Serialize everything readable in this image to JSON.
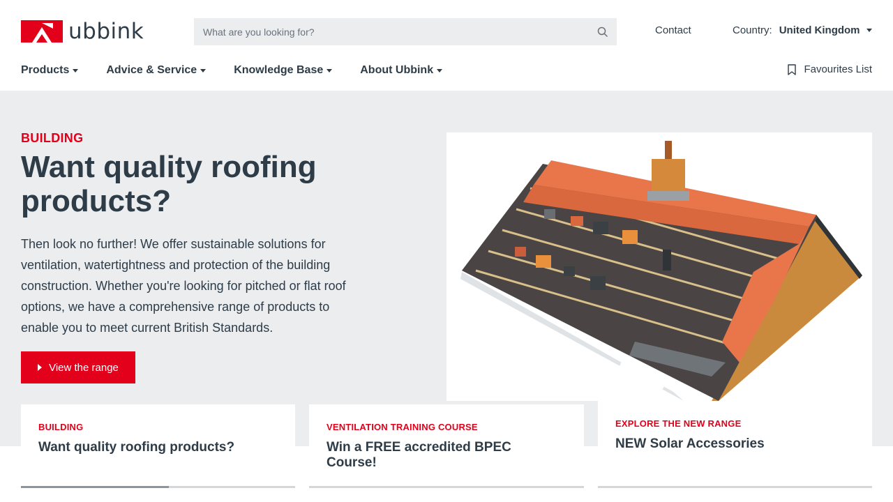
{
  "header": {
    "logo_text": "ubbink",
    "search_placeholder": "What are you looking for?",
    "contact_label": "Contact",
    "country_label": "Country:",
    "country_value": "United Kingdom",
    "favourites_label": "Favourites List"
  },
  "nav": {
    "items": [
      {
        "label": "Products"
      },
      {
        "label": "Advice & Service"
      },
      {
        "label": "Knowledge Base"
      },
      {
        "label": "About Ubbink"
      }
    ]
  },
  "hero": {
    "eyebrow": "BUILDING",
    "title": "Want quality roofing products?",
    "text": "Then look no further! We offer sustainable solutions for ventilation, watertightness and protection of the building construction. Whether you're looking for pitched or flat roof options, we have a comprehensive range of products to enable you to meet current British Standards.",
    "cta_label": "View the range"
  },
  "cards": [
    {
      "eyebrow": "BUILDING",
      "title": "Want quality roofing products?",
      "progress": 0.54
    },
    {
      "eyebrow": "VENTILATION TRAINING COURSE",
      "title": "Win a FREE accredited BPEC Course!",
      "progress": 0
    },
    {
      "eyebrow": "EXPLORE THE NEW RANGE",
      "title": "NEW Solar Accessories",
      "progress": 0
    }
  ],
  "colors": {
    "brand_red": "#e2001a",
    "text_dark": "#2e3c48",
    "hero_bg": "#ebedef"
  }
}
